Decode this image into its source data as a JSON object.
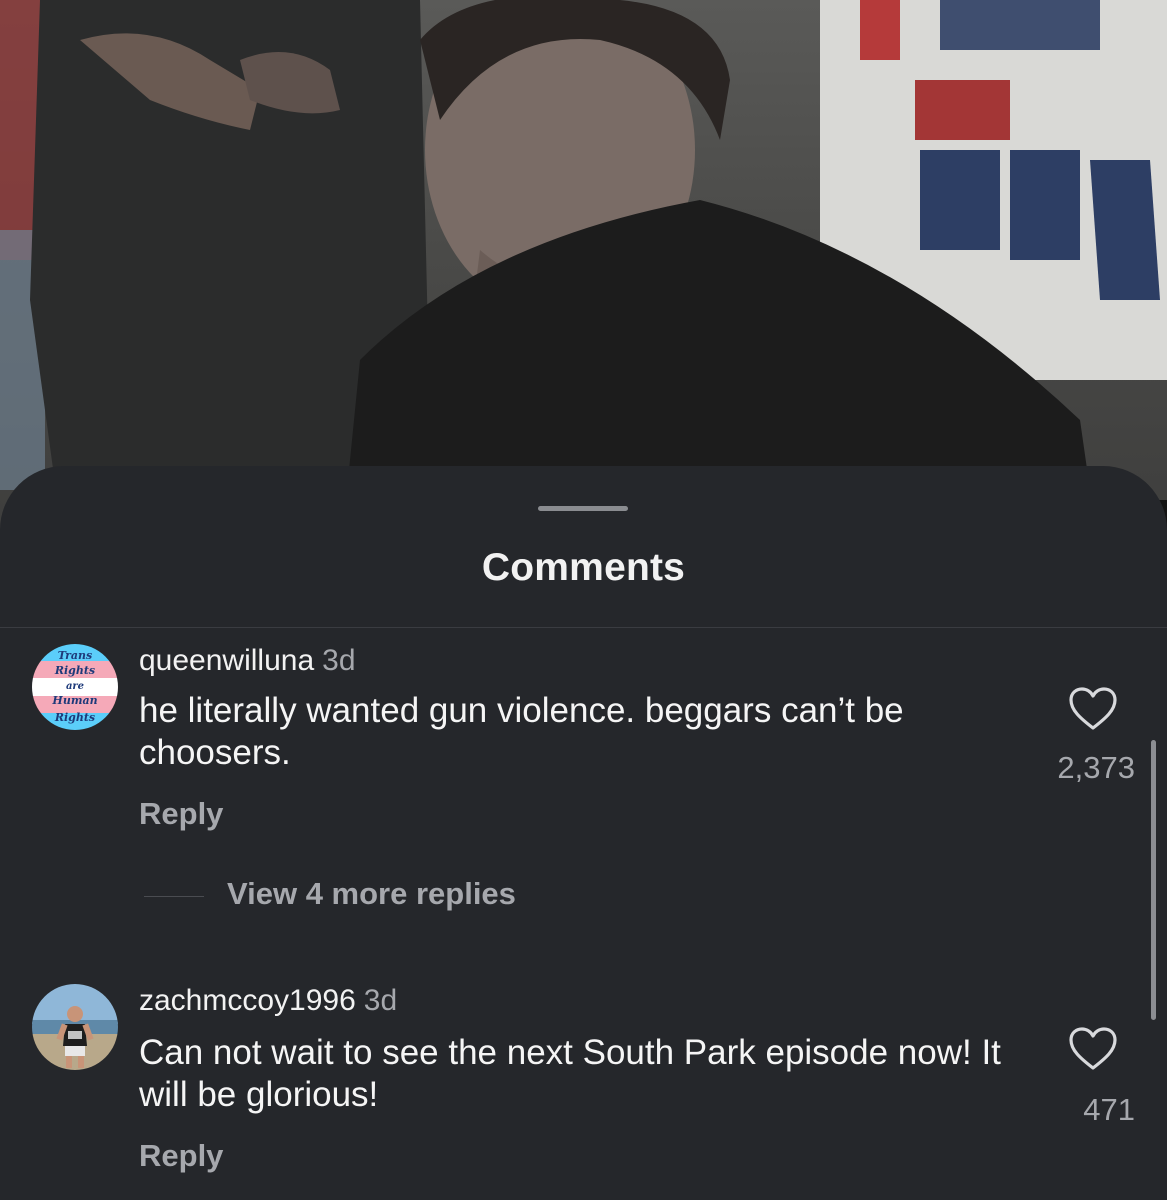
{
  "sheet": {
    "title": "Comments"
  },
  "comments": [
    {
      "username": "queenwilluna",
      "time": "3d",
      "text": "he literally wanted gun violence. beggars can’t be choosers.",
      "reply_label": "Reply",
      "like_count": "2,373",
      "avatar_text": [
        "Trans",
        "Rights",
        "are",
        "Human",
        "Rights"
      ],
      "view_replies_label": "View 4 more replies"
    },
    {
      "username": "zachmccoy1996",
      "time": "3d",
      "text": "Can not wait to see the next South Park episode now! It will be glorious!",
      "reply_label": "Reply",
      "like_count": "471"
    }
  ],
  "icons": {
    "like": "heart-outline-icon"
  },
  "colors": {
    "sheet_bg": "#25272b",
    "primary_text": "#f5f5f5",
    "secondary_text": "#a6a8ad",
    "trans_blue": "#5bcefa",
    "trans_pink": "#f5a9b8"
  }
}
